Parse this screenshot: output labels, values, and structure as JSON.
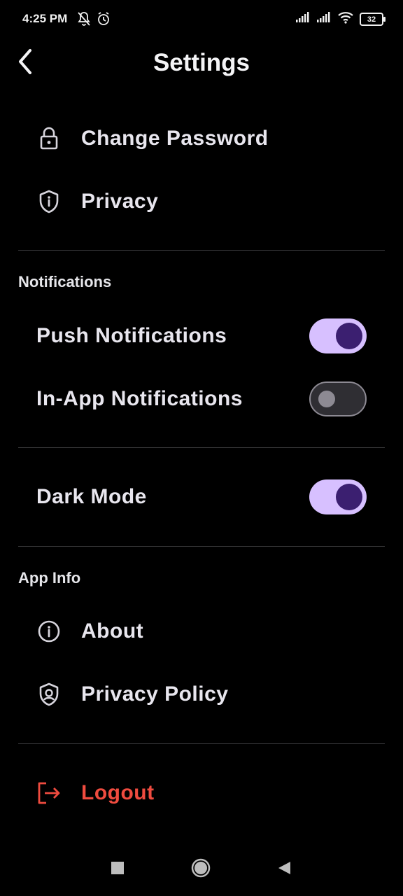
{
  "status_bar": {
    "time": "4:25 PM",
    "battery": "32",
    "left_icons": [
      "bell-off-icon",
      "alarm-icon"
    ],
    "right_icons": [
      "signal-icon",
      "signal-icon",
      "wifi-icon",
      "battery-icon"
    ]
  },
  "header": {
    "title": "Settings",
    "back_icon": "chevron-left-icon"
  },
  "account": {
    "items": [
      {
        "label": "Change Password",
        "icon": "lock-icon"
      },
      {
        "label": "Privacy",
        "icon": "shield-info-icon"
      }
    ]
  },
  "notifications": {
    "section_title": "Notifications",
    "push": {
      "label": "Push Notifications",
      "enabled": true
    },
    "in_app": {
      "label": "In-App Notifications",
      "enabled": false
    }
  },
  "appearance": {
    "dark_mode": {
      "label": "Dark Mode",
      "enabled": true
    }
  },
  "app_info": {
    "section_title": "App Info",
    "items": [
      {
        "label": "About",
        "icon": "info-icon"
      },
      {
        "label": "Privacy Policy",
        "icon": "shield-user-icon"
      }
    ]
  },
  "logout": {
    "label": "Logout",
    "icon": "logout-icon",
    "color": "#ef4b3f"
  },
  "colors": {
    "background": "#000000",
    "toggle_on_track": "#d7c0ff",
    "toggle_on_knob": "#3b1f70",
    "toggle_off_track": "#2f2e33",
    "divider": "#3a3a3c"
  },
  "nav_bar": {
    "buttons": [
      "square-icon",
      "circle-icon",
      "triangle-back-icon"
    ]
  }
}
